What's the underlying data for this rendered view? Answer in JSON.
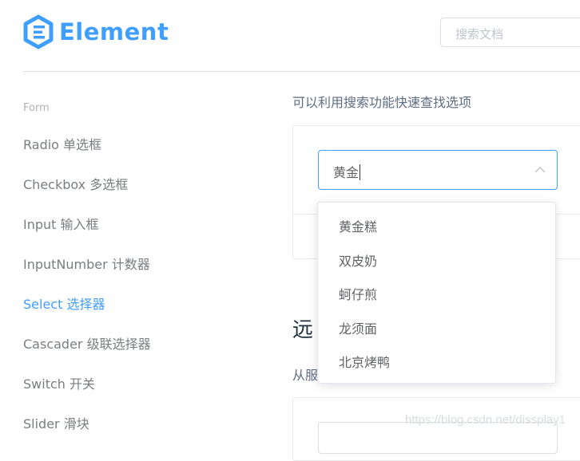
{
  "header": {
    "logo_text": "Element",
    "search_placeholder": "搜索文档",
    "brand_color": "#409EFF"
  },
  "sidebar": {
    "group_label": "Form",
    "items": [
      {
        "label": "Radio 单选框",
        "active": false
      },
      {
        "label": "Checkbox 多选框",
        "active": false
      },
      {
        "label": "Input 输入框",
        "active": false
      },
      {
        "label": "InputNumber 计数器",
        "active": false
      },
      {
        "label": "Select 选择器",
        "active": true
      },
      {
        "label": "Cascader 级联选择器",
        "active": false
      },
      {
        "label": "Switch 开关",
        "active": false
      },
      {
        "label": "Slider 滑块",
        "active": false
      }
    ]
  },
  "main": {
    "filter_description": "可以利用搜索功能快速查找选项",
    "select": {
      "value": "黄金",
      "arrow_icon": "chevron-up-icon"
    },
    "dropdown_options": [
      "黄金糕",
      "双皮奶",
      "蚵仔煎",
      "龙须面",
      "北京烤鸭"
    ],
    "remote_section": {
      "title": "远",
      "description": "从服"
    }
  },
  "watermark": "https://blog.csdn.net/dissplay1"
}
